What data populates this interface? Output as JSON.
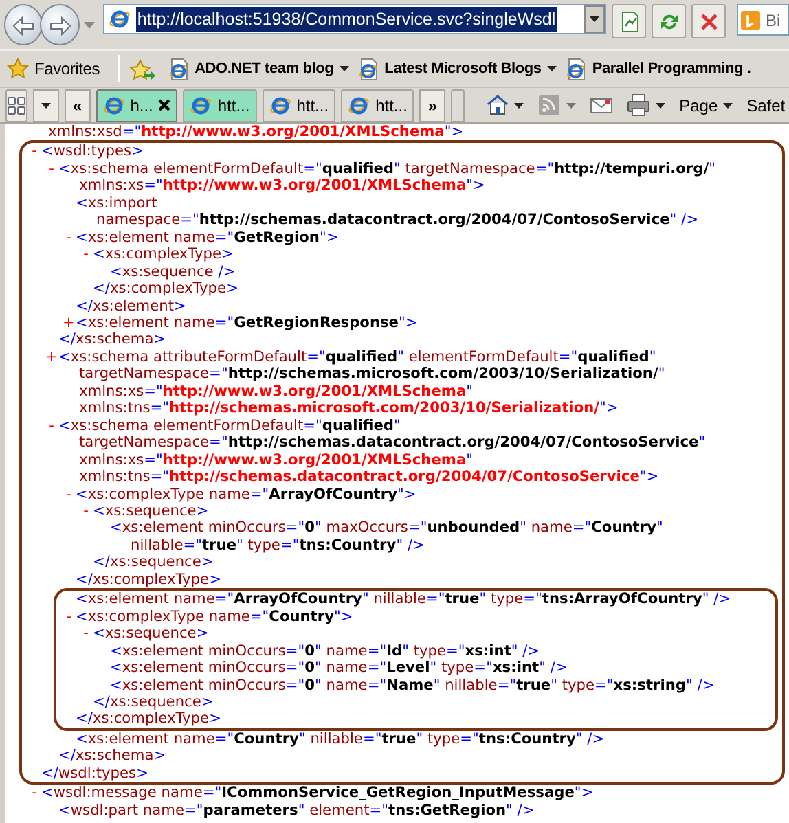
{
  "toolbar": {
    "address": {
      "url": "http://localhost:51938/CommonService.svc?singleWsdl",
      "text_selected": true
    },
    "search": {
      "text": "Bi"
    }
  },
  "favorites_bar": {
    "label": "Favorites",
    "links": [
      {
        "label": "ADO.NET team blog",
        "menu": true
      },
      {
        "label": "Latest Microsoft Blogs",
        "menu": true
      },
      {
        "label": "Parallel Programming .",
        "menu": false
      }
    ]
  },
  "tab_bar": {
    "scroll_left": "«",
    "scroll_right": "»",
    "tabs": [
      {
        "title": "h...",
        "selected": true,
        "grouped": true
      },
      {
        "title": "htt...",
        "selected": false,
        "grouped": true
      },
      {
        "title": "htt...",
        "selected": false,
        "grouped": false
      },
      {
        "title": "htt...",
        "selected": false,
        "grouped": false
      }
    ],
    "commands": [
      {
        "kind": "home",
        "menu": true,
        "disabled": false
      },
      {
        "kind": "feeds",
        "menu": true,
        "disabled": true
      },
      {
        "kind": "mail",
        "menu": false,
        "disabled": false
      },
      {
        "kind": "print",
        "menu": true,
        "disabled": false
      },
      {
        "kind": "page",
        "label": "Page",
        "menu": true,
        "disabled": false
      },
      {
        "kind": "safety",
        "label": "Safet",
        "menu": false,
        "disabled": false
      }
    ]
  },
  "xml": {
    "cut_top": "xmlns:xsd=\"http://www.w3.org/2001/XMLSchema\">",
    "nodes": [
      {
        "kind": "outline",
        "children": [
          {
            "kind": "element",
            "toggle": "-",
            "lines": [
              "<wsdl:types>"
            ],
            "close": "</wsdl:types>",
            "children": [
              {
                "kind": "element",
                "toggle": "-",
                "lines": [
                  "<xs:schema elementFormDefault=\"qualified\" targetNamespace=\"http://tempuri.org/\"",
                  "xmlns:xs=\"http://www.w3.org/2001/XMLSchema\">"
                ],
                "close": "</xs:schema>",
                "children": [
                  {
                    "kind": "element",
                    "lines": [
                      "<xs:import",
                      "namespace=\"http://schemas.datacontract.org/2004/07/ContosoService\" />"
                    ]
                  },
                  {
                    "kind": "element",
                    "toggle": "-",
                    "lines": [
                      "<xs:element name=\"GetRegion\">"
                    ],
                    "close": "</xs:element>",
                    "children": [
                      {
                        "kind": "element",
                        "toggle": "-",
                        "lines": [
                          "<xs:complexType>"
                        ],
                        "close": "</xs:complexType>",
                        "children": [
                          {
                            "kind": "element",
                            "lines": [
                              "<xs:sequence />"
                            ]
                          }
                        ]
                      }
                    ]
                  },
                  {
                    "kind": "element",
                    "toggle": "+",
                    "lines": [
                      "<xs:element name=\"GetRegionResponse\">"
                    ]
                  }
                ]
              },
              {
                "kind": "element",
                "toggle": "+",
                "lines": [
                  "<xs:schema attributeFormDefault=\"qualified\" elementFormDefault=\"qualified\"",
                  "targetNamespace=\"http://schemas.microsoft.com/2003/10/Serialization/\"",
                  "xmlns:xs=\"http://www.w3.org/2001/XMLSchema\"",
                  "xmlns:tns=\"http://schemas.microsoft.com/2003/10/Serialization/\">"
                ]
              },
              {
                "kind": "element",
                "toggle": "-",
                "lines": [
                  "<xs:schema elementFormDefault=\"qualified\"",
                  "targetNamespace=\"http://schemas.datacontract.org/2004/07/ContosoService\"",
                  "xmlns:xs=\"http://www.w3.org/2001/XMLSchema\"",
                  "xmlns:tns=\"http://schemas.datacontract.org/2004/07/ContosoService\">"
                ],
                "close": "</xs:schema>",
                "children": [
                  {
                    "kind": "element",
                    "toggle": "-",
                    "lines": [
                      "<xs:complexType name=\"ArrayOfCountry\">"
                    ],
                    "close": "</xs:complexType>",
                    "children": [
                      {
                        "kind": "element",
                        "toggle": "-",
                        "lines": [
                          "<xs:sequence>"
                        ],
                        "close": "</xs:sequence>",
                        "children": [
                          {
                            "kind": "element",
                            "lines": [
                              "<xs:element minOccurs=\"0\" maxOccurs=\"unbounded\" name=\"Country\"",
                              "nillable=\"true\" type=\"tns:Country\" />"
                            ]
                          }
                        ]
                      }
                    ]
                  },
                  {
                    "kind": "outline",
                    "children": [
                      {
                        "kind": "element",
                        "lines": [
                          "<xs:element name=\"ArrayOfCountry\" nillable=\"true\" type=\"tns:ArrayOfCountry\" />"
                        ]
                      },
                      {
                        "kind": "element",
                        "toggle": "-",
                        "lines": [
                          "<xs:complexType name=\"Country\">"
                        ],
                        "close": "</xs:complexType>",
                        "children": [
                          {
                            "kind": "element",
                            "toggle": "-",
                            "lines": [
                              "<xs:sequence>"
                            ],
                            "close": "</xs:sequence>",
                            "children": [
                              {
                                "kind": "element",
                                "lines": [
                                  "<xs:element minOccurs=\"0\" name=\"Id\" type=\"xs:int\" />"
                                ]
                              },
                              {
                                "kind": "element",
                                "lines": [
                                  "<xs:element minOccurs=\"0\" name=\"Level\" type=\"xs:int\" />"
                                ]
                              },
                              {
                                "kind": "element",
                                "lines": [
                                  "<xs:element minOccurs=\"0\" name=\"Name\" nillable=\"true\" type=\"xs:string\" />"
                                ]
                              }
                            ]
                          }
                        ]
                      }
                    ]
                  },
                  {
                    "kind": "element",
                    "lines": [
                      "<xs:element name=\"Country\" nillable=\"true\" type=\"tns:Country\" />"
                    ]
                  }
                ]
              }
            ]
          }
        ]
      },
      {
        "kind": "element",
        "toggle": "-",
        "lines": [
          "<wsdl:message name=\"ICommonService_GetRegion_InputMessage\">"
        ],
        "children": [
          {
            "kind": "element",
            "lines": [
              "<wsdl:part name=\"parameters\" element=\"tns:GetRegion\" />"
            ]
          }
        ]
      }
    ]
  }
}
